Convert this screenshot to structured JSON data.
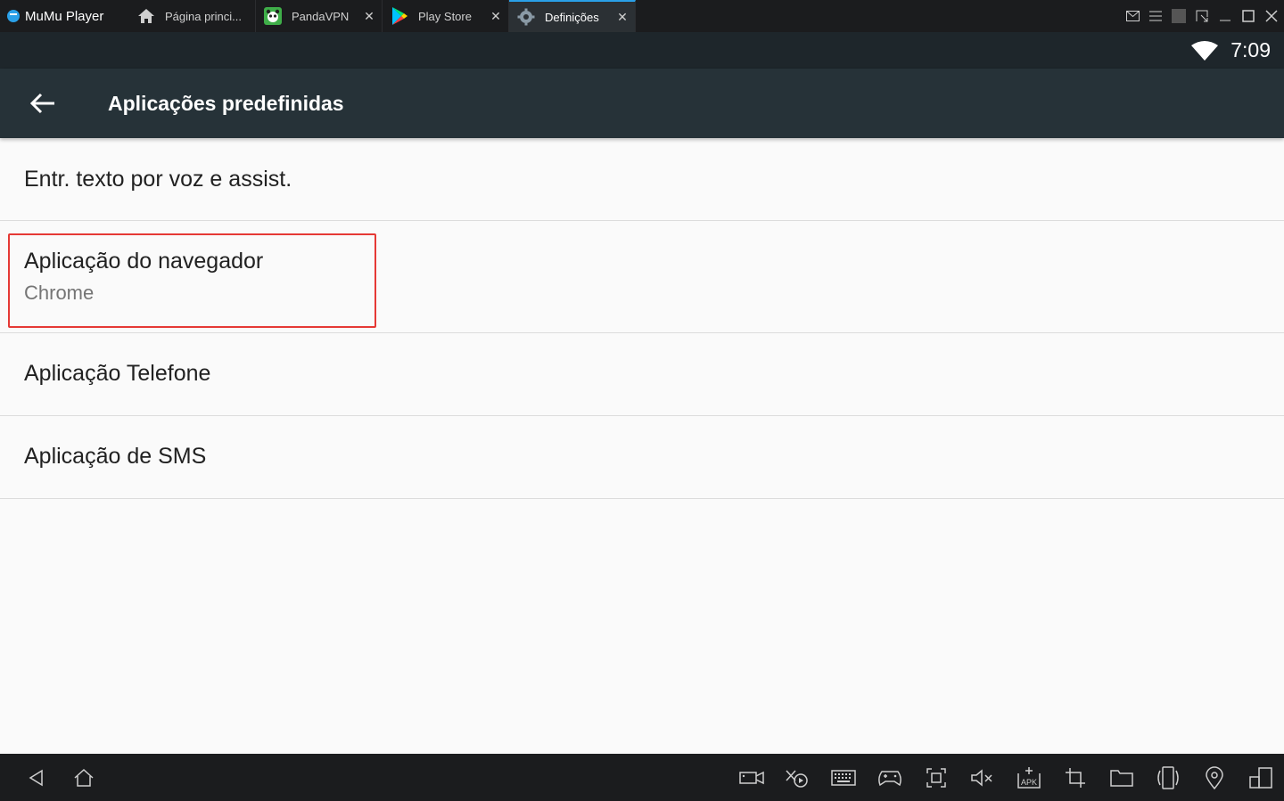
{
  "app": {
    "name": "MuMu Player"
  },
  "tabs": [
    {
      "label": "Página princi...",
      "icon": "home-icon",
      "closable": false,
      "active": false
    },
    {
      "label": "PandaVPN",
      "icon": "pandavpn-icon",
      "closable": true,
      "active": false
    },
    {
      "label": "Play Store",
      "icon": "play-store-icon",
      "closable": true,
      "active": false
    },
    {
      "label": "Definições",
      "icon": "settings-gear-icon",
      "closable": true,
      "active": true
    }
  ],
  "window_controls": [
    "mail-icon",
    "menu-icon",
    "resize-icon",
    "minimize-icon",
    "maximize-icon",
    "close-icon"
  ],
  "status_bar": {
    "time": "7:09",
    "icons": [
      "wifi-icon"
    ]
  },
  "app_bar": {
    "title": "Aplicações predefinidas"
  },
  "list": {
    "items": [
      {
        "title": "Entr. texto por voz e assist.",
        "subtitle": ""
      },
      {
        "title": "Aplicação do navegador",
        "subtitle": "Chrome",
        "highlighted": true
      },
      {
        "title": "Aplicação Telefone",
        "subtitle": ""
      },
      {
        "title": "Aplicação de SMS",
        "subtitle": ""
      }
    ]
  },
  "colors": {
    "titlebar": "#1b1c1e",
    "statusbar": "#1e262b",
    "appbar": "#263238",
    "background": "#fafafa",
    "highlight": "#e53935",
    "active_tab_accent": "#2aa0e8"
  },
  "bottom_toolbar": {
    "nav": [
      "back-nav-icon",
      "home-nav-icon"
    ],
    "tools": [
      "video-record-icon",
      "operation-record-icon",
      "keyboard-icon",
      "gamepad-icon",
      "screenshot-icon",
      "volume-mute-icon",
      "apk-install-icon",
      "crop-icon",
      "folder-icon",
      "rotate-icon",
      "location-icon",
      "multi-window-icon"
    ]
  }
}
